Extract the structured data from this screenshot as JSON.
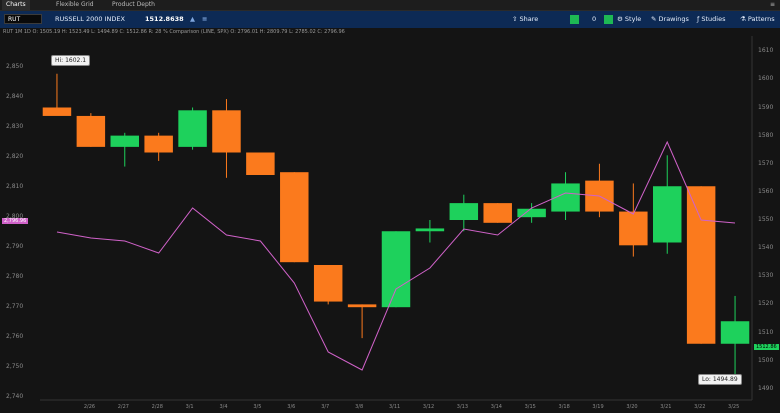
{
  "tabs": [
    {
      "label": "Charts"
    },
    {
      "label": "Flexible Grid"
    },
    {
      "label": "Product Depth"
    }
  ],
  "toolbar": {
    "symbol": "RUT",
    "title": "RUSSELL 2000 INDEX",
    "price": "1512.8638",
    "share": "Share",
    "drawing_count": "0",
    "style": "Style",
    "drawings": "Drawings",
    "studies": "Studies",
    "patterns": "Patterns"
  },
  "statusbar": {
    "text": "RUT 1M 1D   O: 1505.19   H: 1523.49   L: 1494.89   C: 1512.86   R: 28 %   Comparison (LINE, SPX)   O: 2796.01   H: 2809.79   L: 2785.02   C: 2796.96"
  },
  "colors": {
    "up": "#1ed15c",
    "down": "#fb7a1d",
    "line": "#d062c9",
    "accent": "#1eb854"
  },
  "annotations": {
    "high": "Hi: 1602.1",
    "low": "Lo: 1494.89",
    "left_tag": "2,796.96",
    "right_tag": "1512.86"
  },
  "chart_data": {
    "type": "candlestick",
    "categories": [
      "2/26",
      "2/27",
      "2/28",
      "3/1",
      "3/4",
      "3/5",
      "3/6",
      "3/7",
      "3/8",
      "3/11",
      "3/12",
      "3/13",
      "3/14",
      "3/15",
      "3/18",
      "3/19",
      "3/20",
      "3/21",
      "3/22",
      "3/25"
    ],
    "candles": [
      {
        "o": 1590,
        "h": 1602,
        "l": 1588,
        "c": 1587
      },
      {
        "o": 1587,
        "h": 1588,
        "l": 1576,
        "c": 1576
      },
      {
        "o": 1576,
        "h": 1581,
        "l": 1569,
        "c": 1580
      },
      {
        "o": 1580,
        "h": 1581,
        "l": 1571,
        "c": 1574
      },
      {
        "o": 1576,
        "h": 1590,
        "l": 1575,
        "c": 1589
      },
      {
        "o": 1589,
        "h": 1593,
        "l": 1565,
        "c": 1574
      },
      {
        "o": 1574,
        "h": 1574,
        "l": 1566,
        "c": 1566
      },
      {
        "o": 1567,
        "h": 1567,
        "l": 1535,
        "c": 1535
      },
      {
        "o": 1534,
        "h": 1534,
        "l": 1520,
        "c": 1521
      },
      {
        "o": 1520,
        "h": 1520,
        "l": 1508,
        "c": 1519
      },
      {
        "o": 1519,
        "h": 1546,
        "l": 1519,
        "c": 1546
      },
      {
        "o": 1546,
        "h": 1550,
        "l": 1542,
        "c": 1547
      },
      {
        "o": 1550,
        "h": 1559,
        "l": 1546,
        "c": 1556
      },
      {
        "o": 1556,
        "h": 1556,
        "l": 1549,
        "c": 1549
      },
      {
        "o": 1551,
        "h": 1556,
        "l": 1549,
        "c": 1554
      },
      {
        "o": 1553,
        "h": 1567,
        "l": 1550,
        "c": 1563
      },
      {
        "o": 1564,
        "h": 1570,
        "l": 1551,
        "c": 1553
      },
      {
        "o": 1553,
        "h": 1563,
        "l": 1537,
        "c": 1541
      },
      {
        "o": 1542,
        "h": 1573,
        "l": 1538,
        "c": 1562
      },
      {
        "o": 1562,
        "h": 1562,
        "l": 1506,
        "c": 1506
      },
      {
        "o": 1506,
        "h": 1523,
        "l": 1495,
        "c": 1514
      }
    ],
    "comparison": {
      "name": "SPX",
      "values": [
        2795,
        2793,
        2792,
        2788,
        2803,
        2794,
        2792,
        2778,
        2755,
        2749,
        2776,
        2783,
        2796,
        2794,
        2803,
        2808,
        2807,
        2801,
        2825,
        2799,
        2798
      ]
    },
    "y_right": {
      "min": 1486,
      "max": 1614,
      "ticks": [
        1490,
        1500,
        1510,
        1520,
        1530,
        1540,
        1550,
        1560,
        1570,
        1580,
        1590,
        1600,
        1610
      ]
    },
    "y_left": {
      "min": 2739,
      "max": 2859,
      "ticks": [
        2740,
        2750,
        2760,
        2770,
        2780,
        2790,
        2800,
        2810,
        2820,
        2830,
        2840,
        2850
      ]
    }
  }
}
